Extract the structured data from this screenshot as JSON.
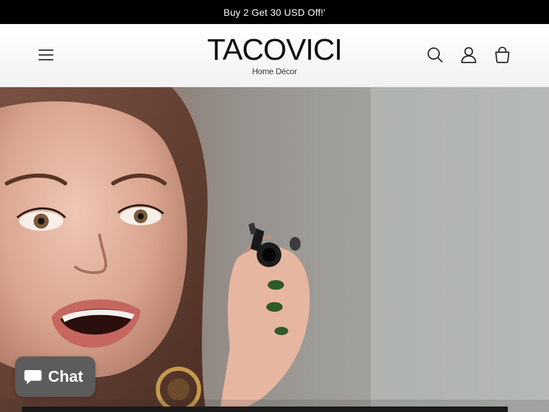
{
  "announcement": {
    "text": "Buy 2 Get 30 USD Off!'"
  },
  "header": {
    "logo": {
      "name": "TACOVICI",
      "tagline": "Home Décor"
    },
    "icons": {
      "menu": "hamburger-menu-icon",
      "search": "search-icon",
      "account": "account-icon",
      "cart": "cart-icon"
    }
  },
  "hero": {
    "image": "woman applying mascara in mirror"
  },
  "chat": {
    "label": "Chat",
    "icon": "chat-bubble-icon"
  },
  "colors": {
    "announcement_bg": "#000000",
    "announcement_text": "#ffffff",
    "header_bg": "#ffffff",
    "chat_bg": "#5c5c5c"
  }
}
